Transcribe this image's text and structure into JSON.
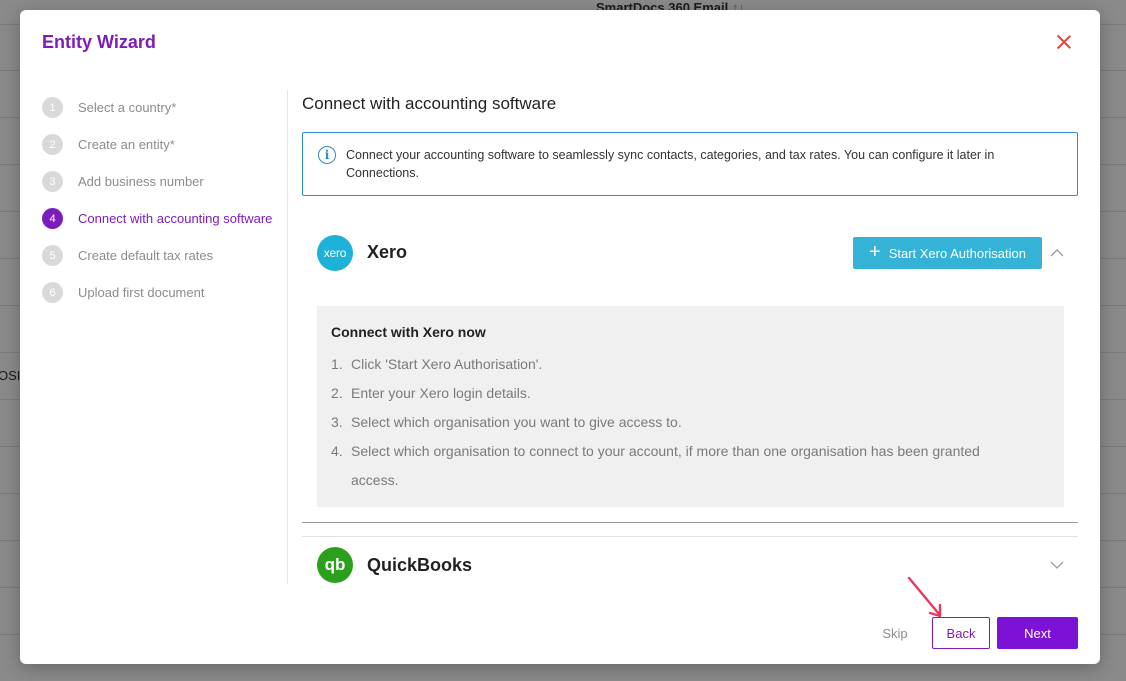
{
  "background": {
    "header_label": "SmartDocs 360 Email",
    "sort_glyph": "↑↓",
    "cell_fragment": "OSI"
  },
  "modal": {
    "title": "Entity Wizard",
    "close_icon": "close-icon"
  },
  "steps": [
    {
      "number": "1",
      "label": "Select a country*",
      "active": false
    },
    {
      "number": "2",
      "label": "Create an entity*",
      "active": false
    },
    {
      "number": "3",
      "label": "Add business number",
      "active": false
    },
    {
      "number": "4",
      "label": "Connect with accounting software",
      "active": true
    },
    {
      "number": "5",
      "label": "Create default tax rates",
      "active": false
    },
    {
      "number": "6",
      "label": "Upload first document",
      "active": false
    }
  ],
  "content": {
    "title": "Connect with accounting software",
    "info_icon": "i",
    "info_text": "Connect your accounting software to seamlessly sync contacts, categories, and tax rates. You can configure it later in Connections."
  },
  "xero": {
    "logo_text": "xero",
    "name": "Xero",
    "auth_button_plus": "+",
    "auth_button_label": "Start Xero Authorisation",
    "expanded": true,
    "instructions_title": "Connect with Xero now",
    "instructions": [
      {
        "n": "1.",
        "text": "Click 'Start Xero Authorisation'."
      },
      {
        "n": "2.",
        "text": "Enter your Xero login details."
      },
      {
        "n": "3.",
        "text": "Select which organisation you want to give access to."
      },
      {
        "n": "4.",
        "text": "Select which organisation to connect to your account, if more than one organisation has been granted access."
      }
    ]
  },
  "quickbooks": {
    "logo_text": "qb",
    "name": "QuickBooks",
    "expanded": false
  },
  "footer": {
    "skip_label": "Skip",
    "back_label": "Back",
    "next_label": "Next"
  },
  "colors": {
    "brand_purple": "#7c1dbb",
    "next_button": "#7c12d6",
    "info_blue": "#2f8dc2",
    "xero_blue": "#1fb2d9",
    "qb_green": "#2ca01c",
    "close_red": "#e0453a",
    "annotation_arrow": "#e8365d"
  }
}
